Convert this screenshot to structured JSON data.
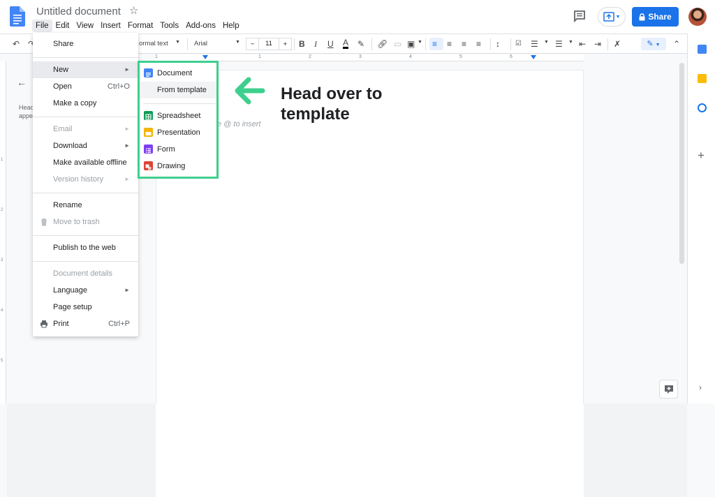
{
  "header": {
    "title": "Untitled document",
    "share_label": "Share",
    "menus": [
      "File",
      "Edit",
      "View",
      "Insert",
      "Format",
      "Tools",
      "Add-ons",
      "Help"
    ]
  },
  "toolbar": {
    "style_value": "ormal text",
    "font_value": "Arial",
    "font_size": "11"
  },
  "ruler": {
    "numbers": [
      "1",
      "1",
      "2",
      "3",
      "4",
      "5",
      "6"
    ]
  },
  "outline": {
    "text": "Head appe"
  },
  "page": {
    "hint": "e @ to insert"
  },
  "file_menu": {
    "items": [
      {
        "label": "Share"
      },
      {
        "label": "New",
        "arrow": "►"
      },
      {
        "label": "Open",
        "shortcut": "Ctrl+O"
      },
      {
        "label": "Make a copy"
      },
      {
        "label": "Email",
        "arrow": "►"
      },
      {
        "label": "Download",
        "arrow": "►"
      },
      {
        "label": "Make available offline"
      },
      {
        "label": "Version history",
        "arrow": "►"
      },
      {
        "label": "Rename"
      },
      {
        "label": "Move to trash"
      },
      {
        "label": "Publish to the web"
      },
      {
        "label": "Document details"
      },
      {
        "label": "Language",
        "arrow": "►"
      },
      {
        "label": "Page setup"
      },
      {
        "label": "Print",
        "shortcut": "Ctrl+P"
      }
    ]
  },
  "new_submenu": {
    "items": [
      {
        "label": "Document",
        "icon": "docs-icon",
        "color": "#4285f4"
      },
      {
        "label": "From template"
      },
      {
        "label": "Spreadsheet",
        "icon": "sheets-icon",
        "color": "#0f9d58"
      },
      {
        "label": "Presentation",
        "icon": "slides-icon",
        "color": "#f4b400"
      },
      {
        "label": "Form",
        "icon": "forms-icon",
        "color": "#7e3ff2"
      },
      {
        "label": "Drawing",
        "icon": "drawings-icon",
        "color": "#db4437"
      }
    ]
  },
  "annotation": {
    "text": "Head over to template",
    "color": "#3ecf8e"
  },
  "colors": {
    "accent": "#1a73e8",
    "highlight_box": "#3ecf8e"
  }
}
